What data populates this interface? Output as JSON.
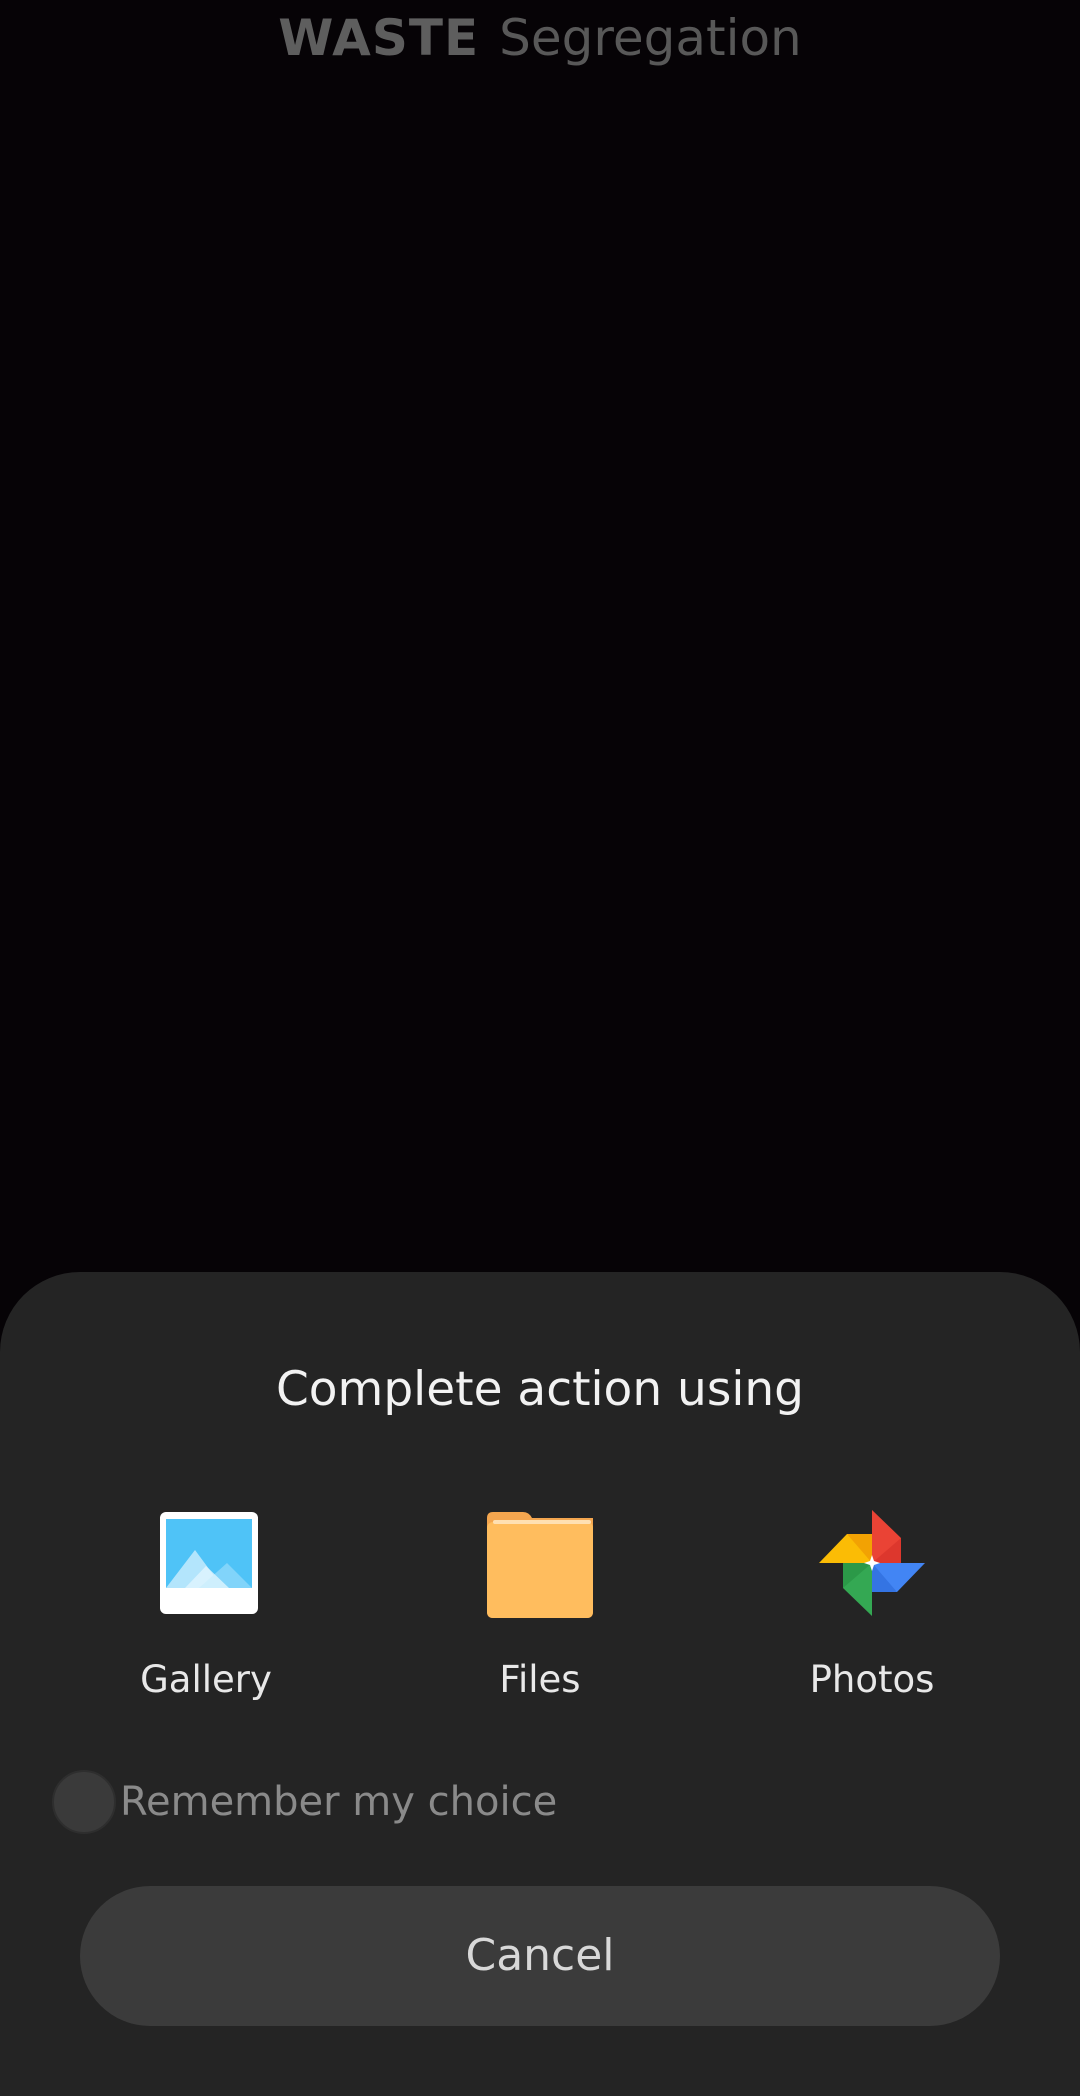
{
  "app": {
    "title_bold": "WASTE",
    "title_light": "Segregation"
  },
  "dialog": {
    "title": "Complete action using",
    "options": [
      {
        "label": "Gallery",
        "icon": "gallery-icon"
      },
      {
        "label": "Files",
        "icon": "folder-icon"
      },
      {
        "label": "Photos",
        "icon": "google-photos-icon"
      }
    ],
    "remember_label": "Remember my choice",
    "cancel_label": "Cancel"
  },
  "colors": {
    "background": "#060306",
    "sheet": "#242424",
    "button": "#3b3b3b",
    "gallery_blue": "#29b6f6",
    "folder_orange": "#ffbd5e"
  }
}
